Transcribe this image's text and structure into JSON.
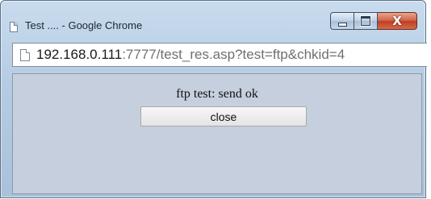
{
  "window": {
    "title": "Test .... - Google Chrome",
    "controls": {
      "minimize_icon": "minimize-icon",
      "maximize_icon": "maximize-icon",
      "close_glyph": "X"
    }
  },
  "address_bar": {
    "icon": "page-icon",
    "host": "192.168.0.111",
    "rest": ":7777/test_res.asp?test=ftp&chkid=4"
  },
  "content": {
    "message": "ftp test: send ok",
    "close_button_label": "close"
  }
}
